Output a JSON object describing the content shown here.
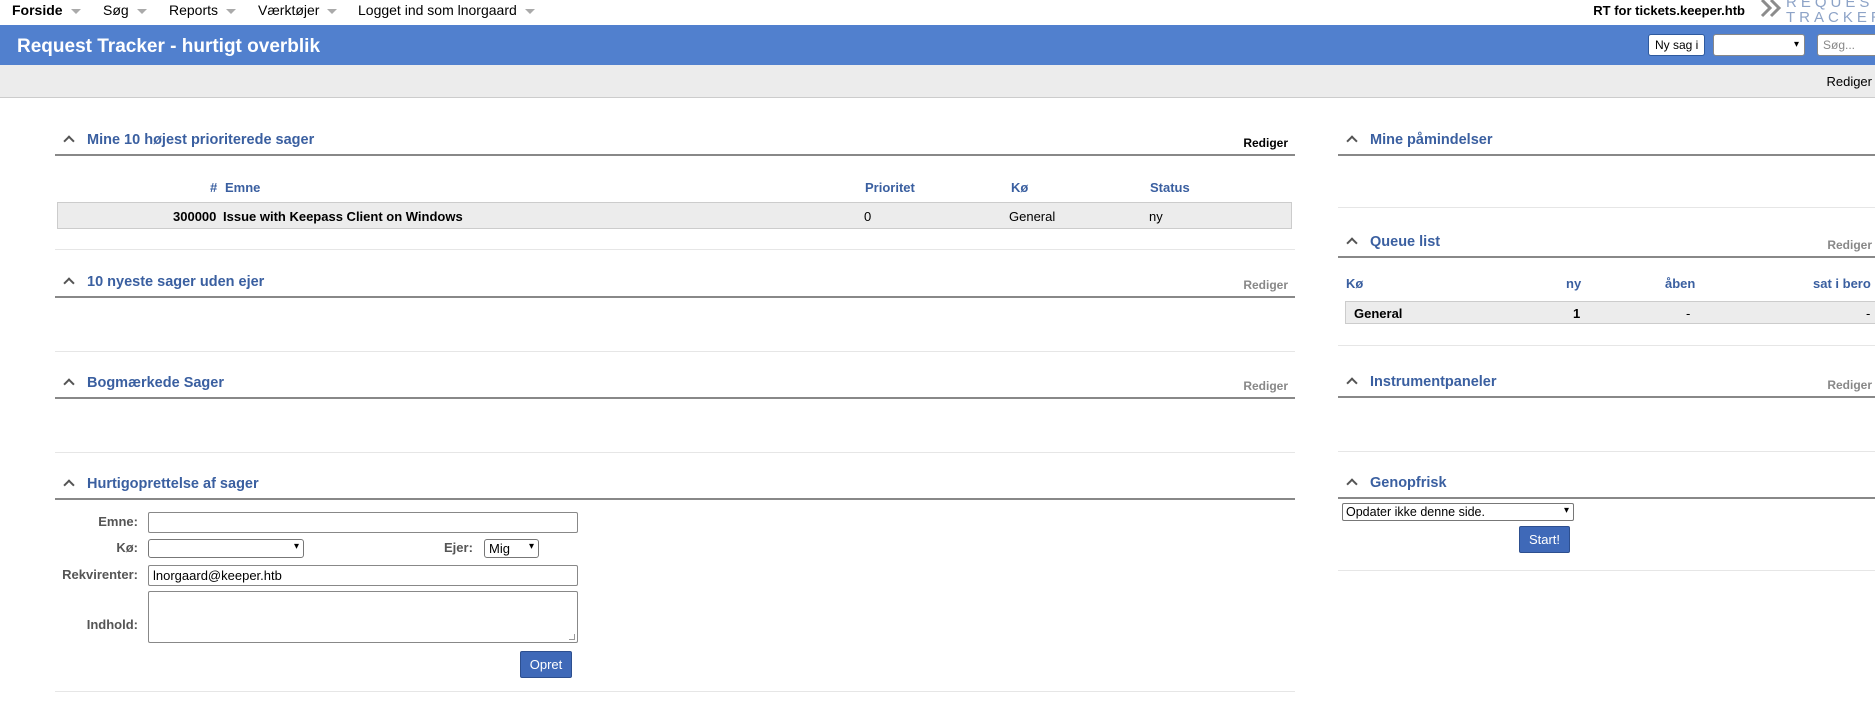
{
  "menu": {
    "items": [
      "Forside",
      "Søg",
      "Reports",
      "Værktøjer",
      "Logget ind som lnorgaard"
    ],
    "rt_for": "RT for tickets.keeper.htb",
    "logo_line1": "REQUEST",
    "logo_line2": "TRACKER"
  },
  "header": {
    "title": "Request Tracker - hurtigt overblik",
    "new_ticket_label": "Ny sag i",
    "queue_value": "",
    "search_placeholder": "Søg..."
  },
  "page": {
    "edit_label": "Rediger"
  },
  "top_tickets": {
    "title": "Mine 10 højest prioriterede sager",
    "edit": "Rediger",
    "columns": {
      "id": "#",
      "subject": "Emne",
      "priority": "Prioritet",
      "queue": "Kø",
      "status": "Status"
    },
    "rows": [
      {
        "id": "300000",
        "subject": "Issue with Keepass Client on Windows",
        "priority": "0",
        "queue": "General",
        "status": "ny"
      }
    ]
  },
  "unowned": {
    "title": "10 nyeste sager uden ejer",
    "edit": "Rediger"
  },
  "bookmarked": {
    "title": "Bogmærkede Sager",
    "edit": "Rediger"
  },
  "quick_create": {
    "title": "Hurtigoprettelse af sager",
    "subject_label": "Emne:",
    "subject_value": "",
    "queue_label": "Kø:",
    "queue_value": "",
    "owner_label": "Ejer:",
    "owner_value": "Mig",
    "requestors_label": "Rekvirenter:",
    "requestors_value": "lnorgaard@keeper.htb",
    "content_label": "Indhold:",
    "content_value": "",
    "submit_label": "Opret"
  },
  "reminders": {
    "title": "Mine påmindelser"
  },
  "queue_list": {
    "title": "Queue list",
    "edit": "Rediger",
    "columns": {
      "queue": "Kø",
      "new": "ny",
      "open": "åben",
      "stalled": "sat i bero"
    },
    "rows": [
      {
        "queue": "General",
        "new": "1",
        "open": "-",
        "stalled": "-"
      }
    ]
  },
  "dashboards": {
    "title": "Instrumentpaneler",
    "edit": "Rediger"
  },
  "refresh": {
    "title": "Genopfrisk",
    "select_value": "Opdater ikke denne side.",
    "submit_label": "Start!"
  },
  "colors": {
    "header": "#5180ce",
    "title_text": "#3a5fa0",
    "button": "#3f69b8"
  }
}
